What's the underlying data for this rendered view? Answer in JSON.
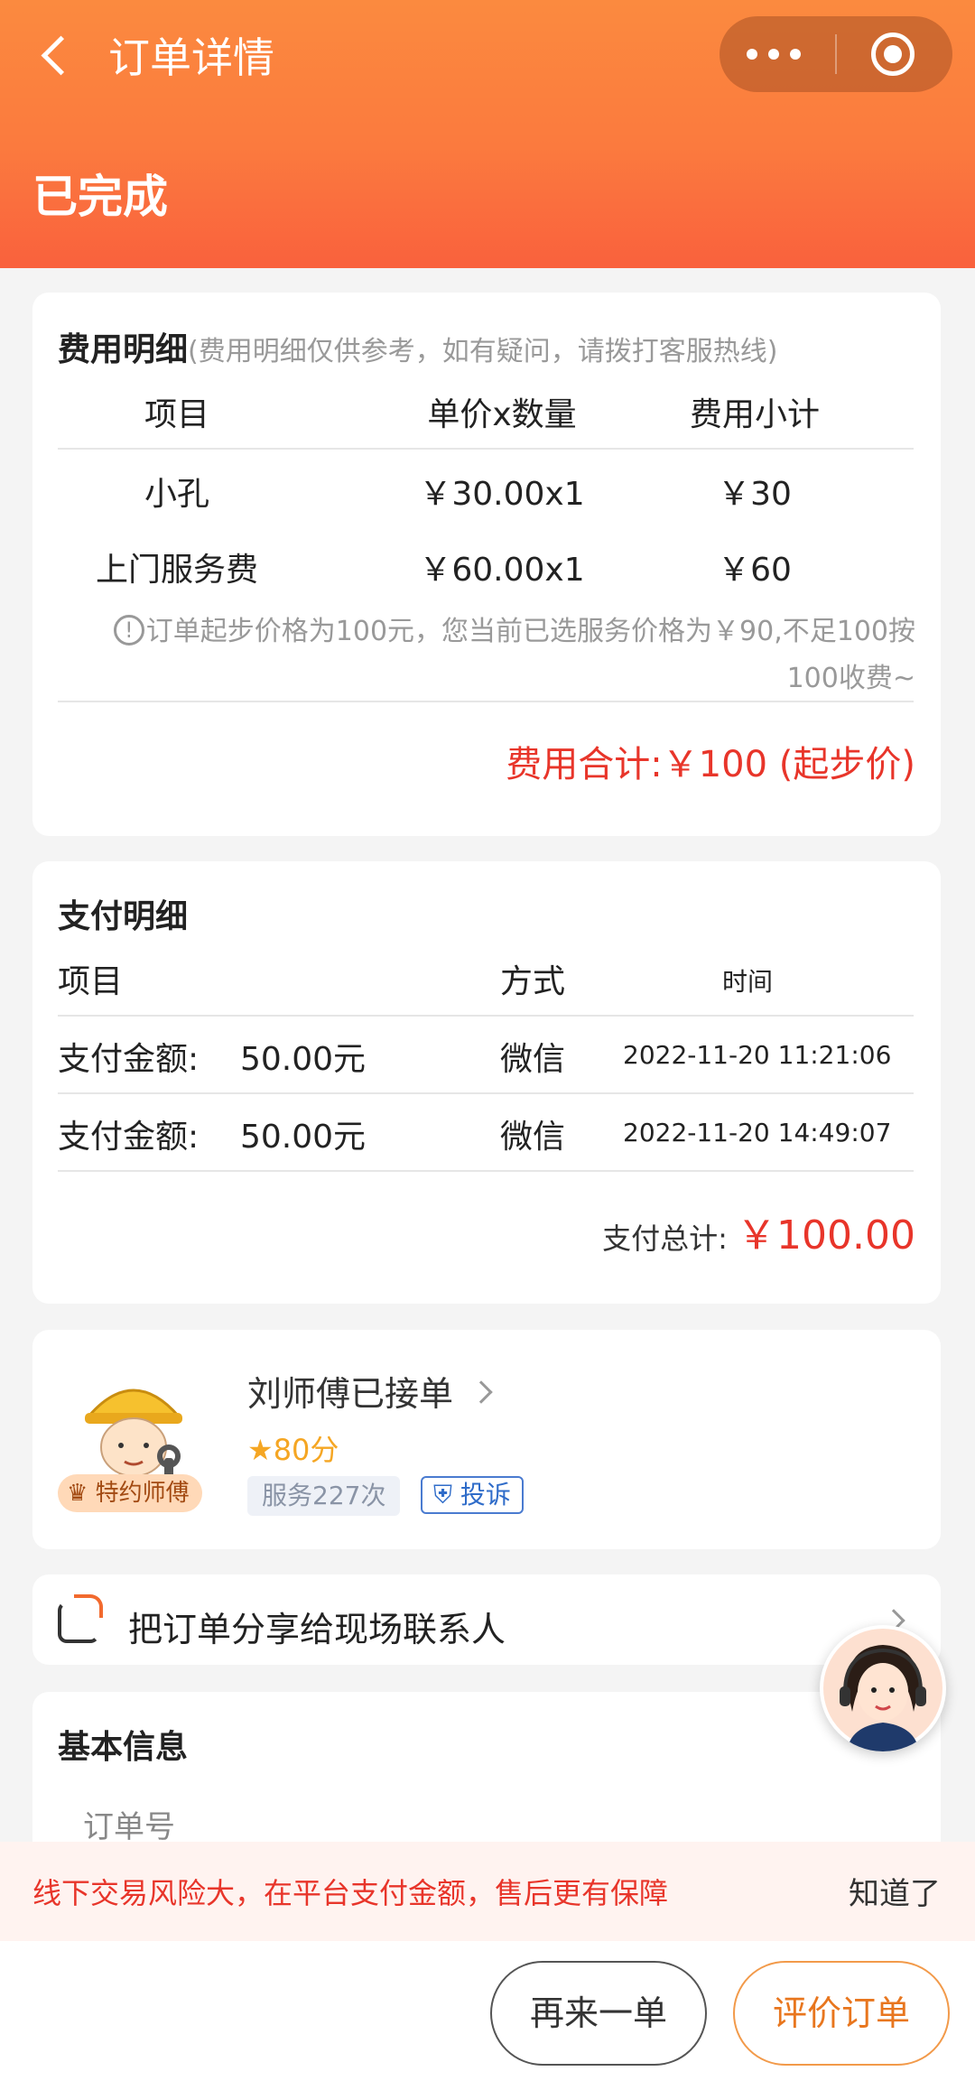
{
  "header": {
    "title": "订单详情",
    "status": "已完成"
  },
  "fee": {
    "title": "费用明细",
    "subtitle": "(费用明细仅供参考，如有疑问，请拨打客服热线)",
    "columns": [
      "项目",
      "单价x数量",
      "费用小计"
    ],
    "rows": [
      {
        "item": "小孔",
        "price": "￥30.00x1",
        "subtotal": "￥30"
      },
      {
        "item": "上门服务费",
        "price": "￥60.00x1",
        "subtotal": "￥60"
      }
    ],
    "note_line1": "订单起步价格为100元，您当前已选服务价格为￥90,不足100按",
    "note_line2": "100收费~",
    "total": "费用合计:￥100 (起步价)"
  },
  "payment": {
    "title": "支付明细",
    "columns": [
      "项目",
      "方式",
      "时间"
    ],
    "rows": [
      {
        "label": "支付金额:",
        "amount": "50.00元",
        "method": "微信",
        "time": "2022-11-20 11:21:06"
      },
      {
        "label": "支付金额:",
        "amount": "50.00元",
        "method": "微信",
        "time": "2022-11-20 14:49:07"
      }
    ],
    "total_label": "支付总计:",
    "total_value": "￥100.00"
  },
  "master": {
    "name": "刘师傅已接单",
    "rating": "80分",
    "badge": "特约师傅",
    "service_count": "服务227次",
    "complain": "投诉"
  },
  "share": {
    "label": "把订单分享给现场联系人"
  },
  "basic": {
    "title": "基本信息",
    "order_label": "订单号"
  },
  "risk": {
    "text": "线下交易风险大，在平台支付金额，售后更有保障",
    "ok": "知道了"
  },
  "actions": {
    "reorder": "再来一单",
    "review": "评价订单"
  },
  "colors": {
    "header_orange": "#fb7a3e",
    "price_red": "#e8352a",
    "accent_orange": "#e8761e"
  }
}
